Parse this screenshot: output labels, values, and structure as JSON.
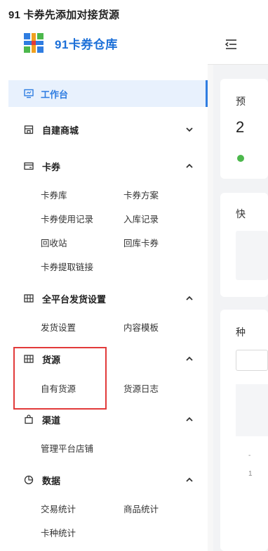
{
  "page": {
    "title": "91 卡券先添加对接货源"
  },
  "logo": {
    "text": "91卡券仓库"
  },
  "nav": {
    "workbench": {
      "label": "工作台",
      "icon": "monitor-icon"
    },
    "groups": [
      {
        "key": "mall",
        "label": "自建商城",
        "icon": "store-icon",
        "expanded": false,
        "items": []
      },
      {
        "key": "coupon",
        "label": "卡券",
        "icon": "card-icon",
        "expanded": true,
        "items": [
          "卡券库",
          "卡券方案",
          "卡券使用记录",
          "入库记录",
          "回收站",
          "回库卡券",
          "卡券提取链接"
        ]
      },
      {
        "key": "shipping",
        "label": "全平台发货设置",
        "icon": "grid-icon",
        "expanded": true,
        "items": [
          "发货设置",
          "内容模板"
        ]
      },
      {
        "key": "source",
        "label": "货源",
        "icon": "grid-icon",
        "expanded": true,
        "items": [
          "自有货源",
          "货源日志"
        ]
      },
      {
        "key": "channel",
        "label": "渠道",
        "icon": "bag-icon",
        "expanded": true,
        "items": [
          "管理平台店铺"
        ]
      },
      {
        "key": "data",
        "label": "数据",
        "icon": "pie-chart-icon",
        "expanded": true,
        "items": [
          "交易统计",
          "商品统计",
          "卡种统计"
        ]
      }
    ]
  },
  "main": {
    "card1": {
      "glyph": "预",
      "digit": "2"
    },
    "card2": {
      "glyph": "快"
    },
    "card3": {
      "glyph": "种",
      "mark_a": "-",
      "mark_b": "1"
    }
  },
  "colors": {
    "accent": "#2f7de1",
    "highlight": "#e23a3a",
    "logo": "#1b6fd8"
  }
}
